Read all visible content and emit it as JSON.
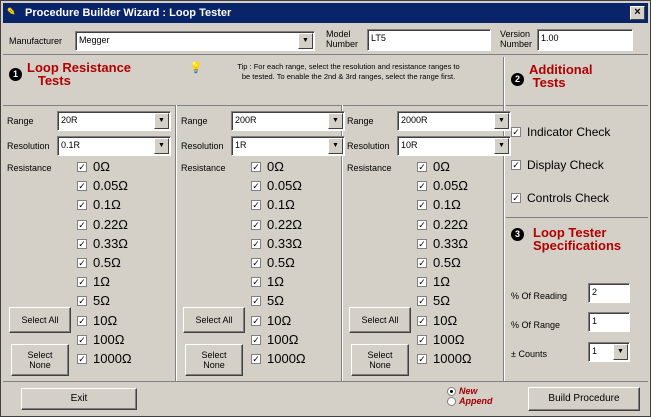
{
  "window": {
    "title": "Procedure Builder Wizard : Loop Tester",
    "close": "×"
  },
  "header": {
    "manufacturer_label": "Manufacturer",
    "manufacturer_value": "Megger",
    "model_label1": "Model",
    "model_label2": "Number",
    "model_value": "LT5",
    "version_label1": "Version",
    "version_label2": "Number",
    "version_value": "1.00"
  },
  "loop": {
    "num": "1",
    "title1": "Loop Resistance",
    "title2": "Tests",
    "tip1": "Tip : For each range, select the resolution and resistance ranges to",
    "tip2": "be tested. To enable the 2nd & 3rd ranges, select the range first.",
    "range_label": "Range",
    "resolution_label": "Resolution",
    "resistance_label": "Resistance",
    "select_all": "Select All",
    "select_none1": "Select",
    "select_none2": "None",
    "columns": [
      {
        "range": "20R",
        "resolution": "0.1R"
      },
      {
        "range": "200R",
        "resolution": "1R"
      },
      {
        "range": "2000R",
        "resolution": "10R"
      }
    ],
    "resistances": [
      "0Ω",
      "0.05Ω",
      "0.1Ω",
      "0.22Ω",
      "0.33Ω",
      "0.5Ω",
      "1Ω",
      "5Ω",
      "10Ω",
      "100Ω",
      "1000Ω"
    ]
  },
  "additional": {
    "num": "2",
    "title1": "Additional",
    "title2": "Tests",
    "checks": [
      "Indicator Check",
      "Display Check",
      "Controls Check"
    ]
  },
  "specs": {
    "num": "3",
    "title1": "Loop Tester",
    "title2": "Specifications",
    "reading_label": "% Of Reading",
    "reading_value": "2",
    "range_label": "% Of Range",
    "range_value": "1",
    "counts_label": "± Counts",
    "counts_value": "1"
  },
  "footer": {
    "exit": "Exit",
    "new": "New",
    "append": "Append",
    "build": "Build Procedure"
  }
}
